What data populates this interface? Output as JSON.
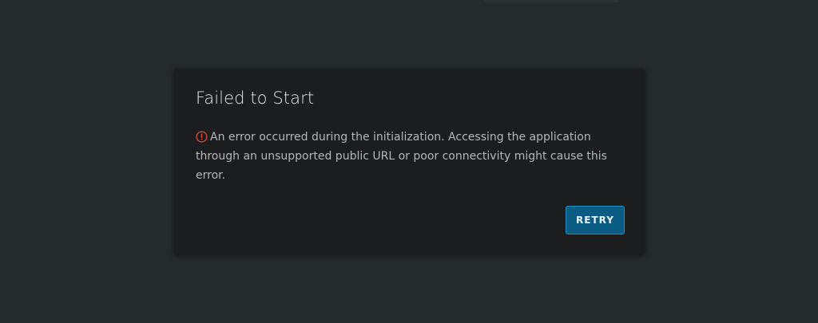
{
  "dialog": {
    "title": "Failed to Start",
    "message": "An error occurred during the initialization. Accessing the application through an unsupported public URL or poor connectivity might cause this error.",
    "icon": "error-circle-icon",
    "retry_label": "RETRY"
  },
  "colors": {
    "background": "#252a2b",
    "dialog_background": "#1b1d1e",
    "error_icon": "#e0533d",
    "button_background": "#0a5c85",
    "button_border": "#1b8ec2"
  }
}
